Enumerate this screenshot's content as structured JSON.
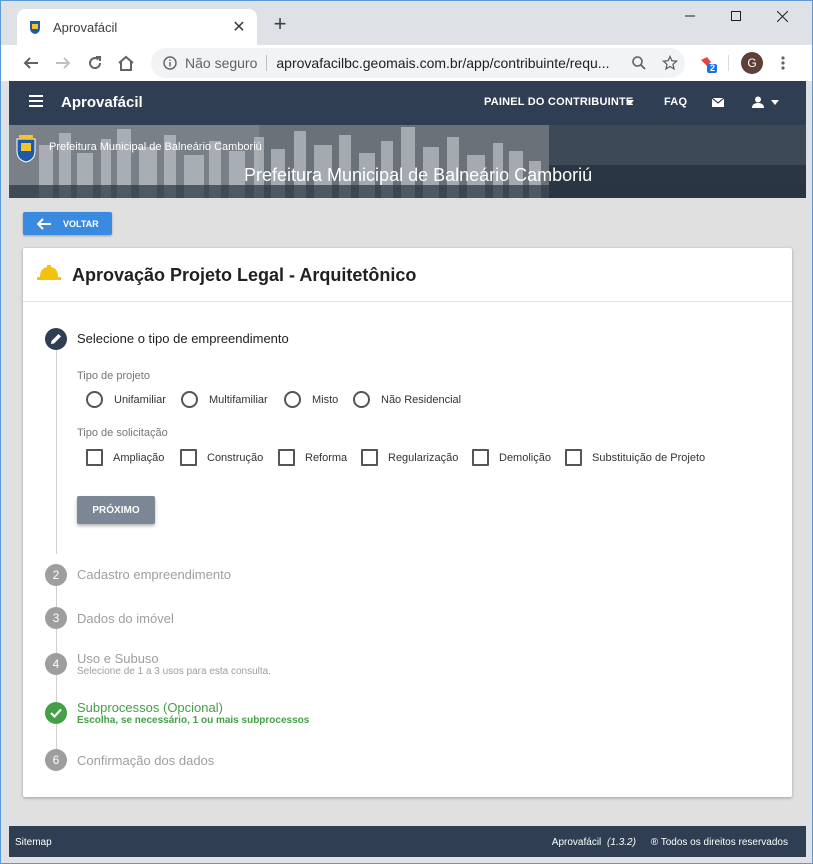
{
  "browser": {
    "tab_title": "Aprovafácil",
    "tab_close": "✕",
    "new_tab": "+",
    "security_label": "Não seguro",
    "url": "aprovafacilbc.geomais.com.br/app/contribuinte/requ...",
    "profile_initial": "G",
    "extension_badge": "2"
  },
  "appbar": {
    "brand": "Aprovafácil",
    "nav_panel": "PAINEL DO CONTRIBUINTE",
    "nav_faq": "FAQ"
  },
  "hero": {
    "small_title": "Prefeitura Municipal de Balneário Camboriú",
    "big_title": "Prefeitura Municipal de Balneário Camboriú"
  },
  "back_button": "VOLTAR",
  "card": {
    "title": "Aprovação Projeto Legal - Arquitetônico",
    "step1": {
      "title": "Selecione o tipo de empreendimento",
      "project_type_label": "Tipo de projeto",
      "project_types": [
        "Unifamiliar",
        "Multifamiliar",
        "Misto",
        "Não Residencial"
      ],
      "request_type_label": "Tipo de solicitação",
      "request_types": [
        "Ampliação",
        "Construção",
        "Reforma",
        "Regularização",
        "Demolição",
        "Substituição de Projeto"
      ],
      "next_button": "PRÓXIMO"
    },
    "steps": [
      {
        "number": "2",
        "title": "Cadastro empreendimento"
      },
      {
        "number": "3",
        "title": "Dados do imóvel"
      },
      {
        "number": "4",
        "title": "Uso e Subuso",
        "subtitle": "Selecione de 1 a 3 usos para esta consulta."
      },
      {
        "number": "",
        "title": "Subprocessos (Opcional)",
        "subtitle": "Escolha, se necessário, 1 ou mais subprocessos"
      },
      {
        "number": "6",
        "title": "Confirmação dos dados"
      }
    ]
  },
  "footer": {
    "left": "Sitemap",
    "app_name": "Aprovafácil",
    "version": "(1.3.2)",
    "rights": "® Todos os direitos reservados"
  },
  "colors": {
    "appbar": "#2f3e52",
    "primary": "#3a8be0",
    "success": "#43a047",
    "disabled_step": "#9e9e9e"
  }
}
